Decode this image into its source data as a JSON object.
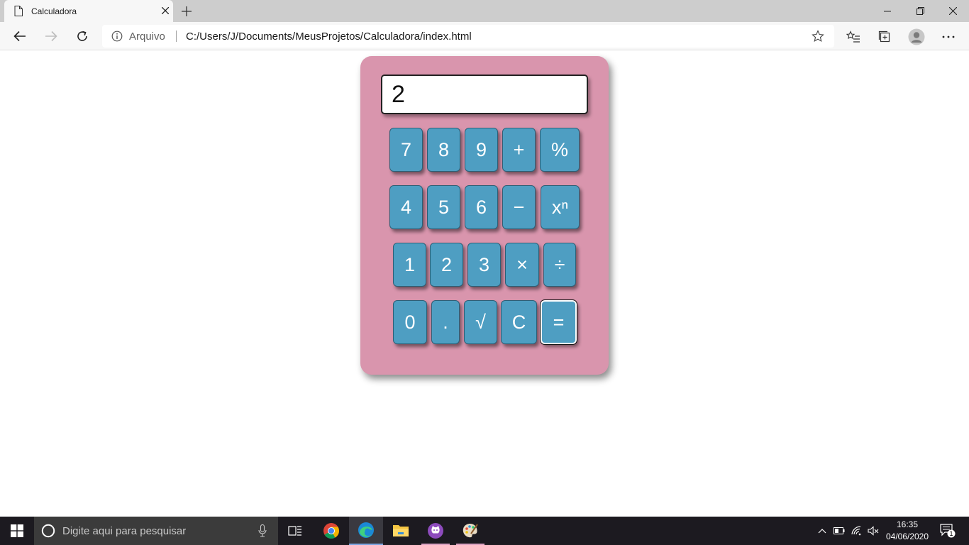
{
  "browser": {
    "tab": {
      "title": "Calculadora"
    },
    "address": {
      "scheme_label": "Arquivo",
      "url": "C:/Users/J/Documents/MeusProjetos/Calculadora/index.html"
    }
  },
  "calculator": {
    "display": "2",
    "rows": [
      [
        "7",
        "8",
        "9",
        "+",
        "%"
      ],
      [
        "4",
        "5",
        "6",
        "−",
        "xⁿ"
      ],
      [
        "1",
        "2",
        "3",
        "×",
        "÷"
      ],
      [
        "0",
        ".",
        "√",
        "C",
        "="
      ]
    ]
  },
  "taskbar": {
    "search_placeholder": "Digite aqui para pesquisar",
    "time": "16:35",
    "date": "04/06/2020",
    "notification_count": "1"
  },
  "colors": {
    "calc_body": "#d995ad",
    "key": "#4e9ec2",
    "taskbar": "#1c1a20"
  }
}
